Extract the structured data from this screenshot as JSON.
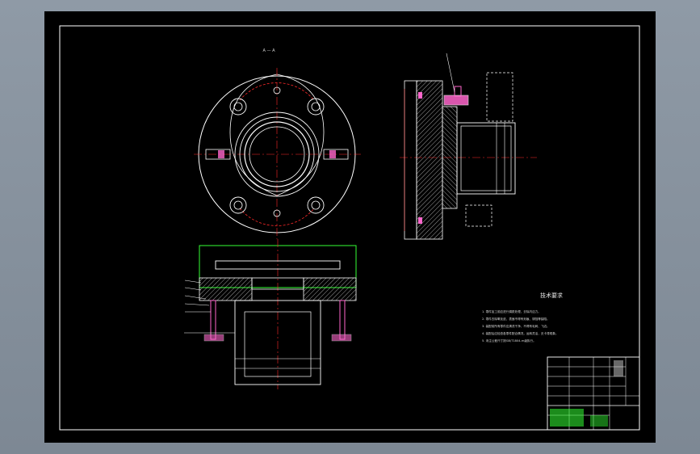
{
  "drawing": {
    "section_label": "A — A",
    "tech_title": "技术要求",
    "tech_notes": [
      "1. 零件加工前应进行调质处理，去除内应力。",
      "2. 零件去除氧化皮，表面不得有划痕、锈蚀等缺陷。",
      "3. 装配前所有零件应清洗干净，不得有毛刺、飞边。",
      "4. 装配后应检查各零件配合情况，运转灵活，无卡滞现象。",
      "5. 未注公差尺寸按GB/T1804-m级执行。"
    ],
    "colors": {
      "background": "#000000",
      "line": "#ffffff",
      "center_line": "#ff2a2a",
      "highlight": "#33ff33",
      "hatch": "#c8c8c8",
      "bolt": "#ff66cc"
    }
  }
}
